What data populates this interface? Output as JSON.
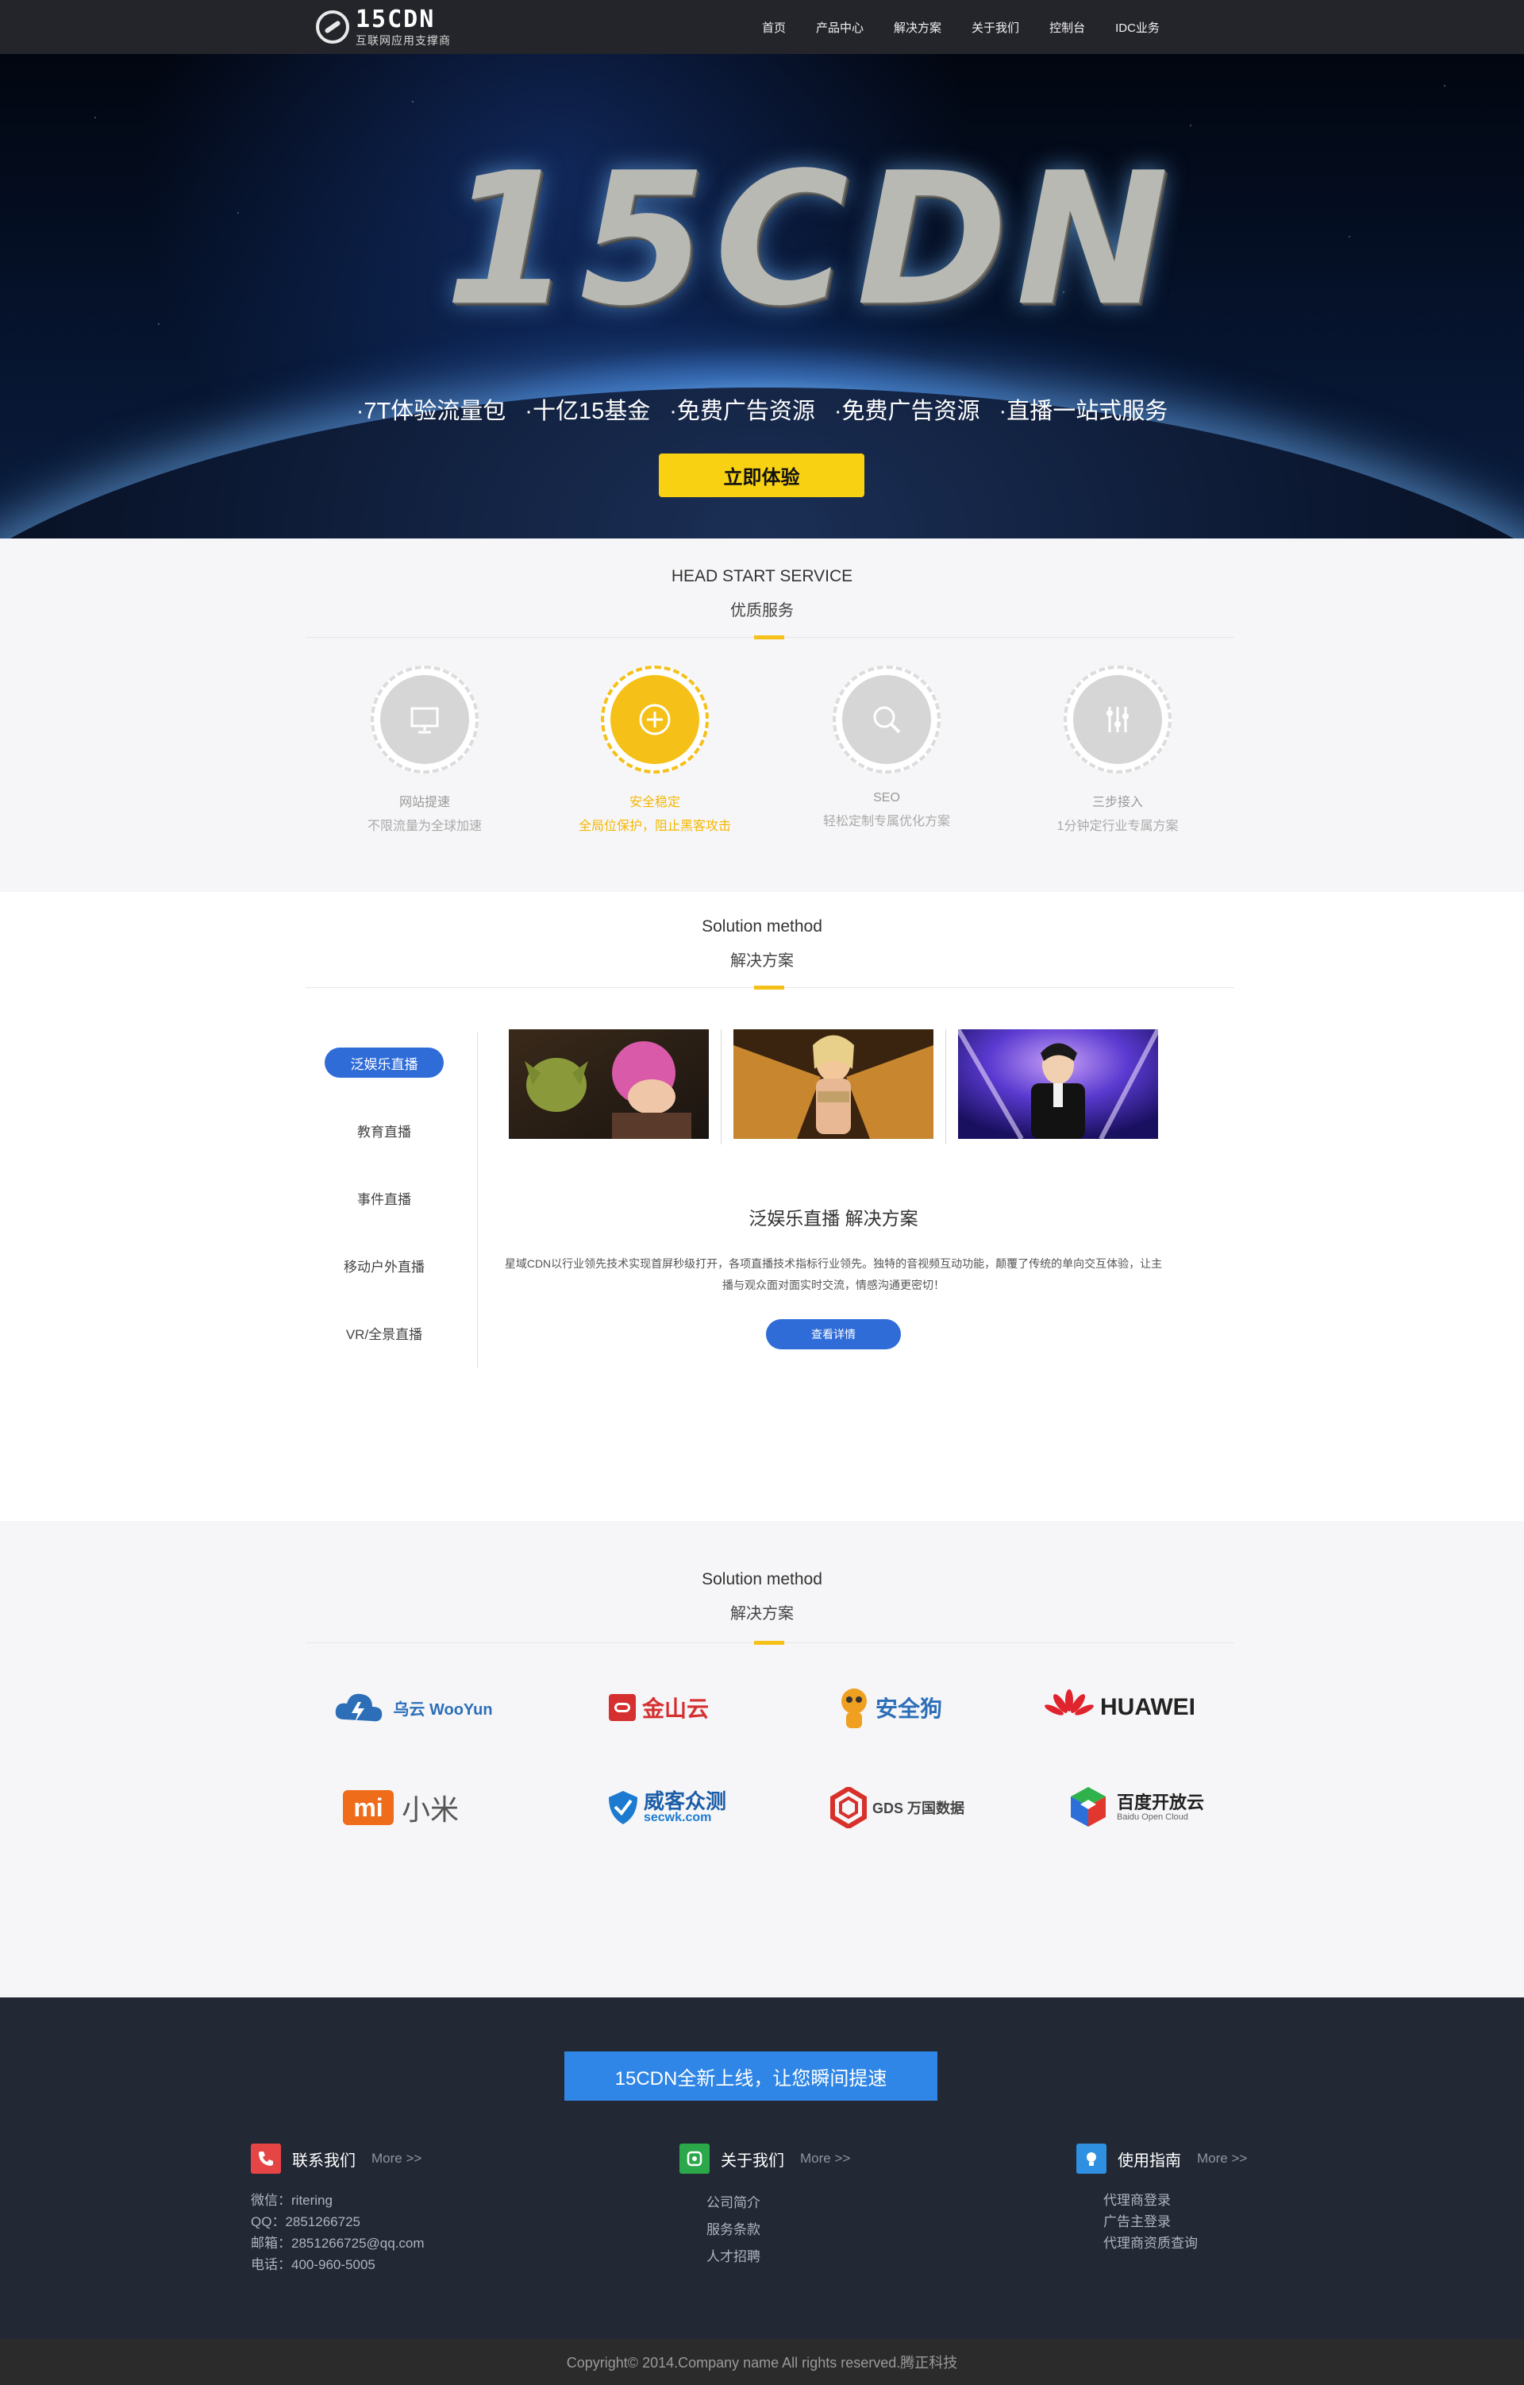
{
  "header": {
    "logo_title": "15CDN",
    "logo_subtitle": "互联网应用支撑商",
    "nav": [
      "首页",
      "产品中心",
      "解决方案",
      "关于我们",
      "控制台",
      "IDC业务"
    ]
  },
  "banner": {
    "title": "15CDN",
    "features": [
      "·7T体验流量包",
      "·十亿15基金",
      "·免费广告资源",
      "·免费广告资源",
      "·直播一站式服务"
    ],
    "cta": "立即体验"
  },
  "services": {
    "heading_en": "HEAD START SERVICE",
    "heading_cn": "优质服务",
    "items": [
      {
        "icon": "monitor-icon",
        "title": "网站提速",
        "desc": "不限流量为全球加速"
      },
      {
        "icon": "plus-circle-icon",
        "title": "安全稳定",
        "desc": "全局位保护，阻止黑客攻击"
      },
      {
        "icon": "search-icon",
        "title": "SEO",
        "desc": "轻松定制专属优化方案"
      },
      {
        "icon": "sliders-icon",
        "title": "三步接入",
        "desc": "1分钟定行业专属方案"
      }
    ]
  },
  "solutions": {
    "heading_en": "Solution method",
    "heading_cn": "解决方案",
    "tabs": [
      "泛娱乐直播",
      "教育直播",
      "事件直播",
      "移动户外直播",
      "VR/全景直播"
    ],
    "title": "泛娱乐直播 解决方案",
    "description": "星域CDN以行业领先技术实现首屏秒级打开，各项直播技术指标行业领先。独特的音视频互动功能，颠覆了传统的单向交互体验，让主播与观众面对面实时交流，情感沟通更密切！",
    "button": "查看详情"
  },
  "partners": {
    "heading_en": "Solution method",
    "heading_cn": "解决方案",
    "logos": [
      "乌云 WooYun",
      "金山云",
      "安全狗",
      "HUAWEI",
      "小米",
      "威客众测",
      "GDS 万国数据",
      "百度开放云"
    ],
    "logo_sub": [
      "secwk.com",
      "Baidu Open Cloud"
    ]
  },
  "footer": {
    "banner": "15CDN全新上线，让您瞬间提速",
    "more": "More >>",
    "contact": {
      "title": "联系我们",
      "lines": [
        "微信：ritering",
        "QQ：2851266725",
        "邮箱：2851266725@qq.com",
        "电话：400-960-5005"
      ]
    },
    "about": {
      "title": "关于我们",
      "links": [
        "公司简介",
        "服务条款",
        "人才招聘"
      ]
    },
    "guide": {
      "title": "使用指南",
      "links": [
        "代理商登录",
        "广告主登录",
        "代理商资质查询"
      ]
    },
    "copyright": "Copyright© 2014.Company name All rights reserved.腾正科技"
  },
  "colors": {
    "accent_yellow": "#f5c018",
    "primary_blue": "#2f6cd8",
    "footer_bg": "#222834"
  }
}
